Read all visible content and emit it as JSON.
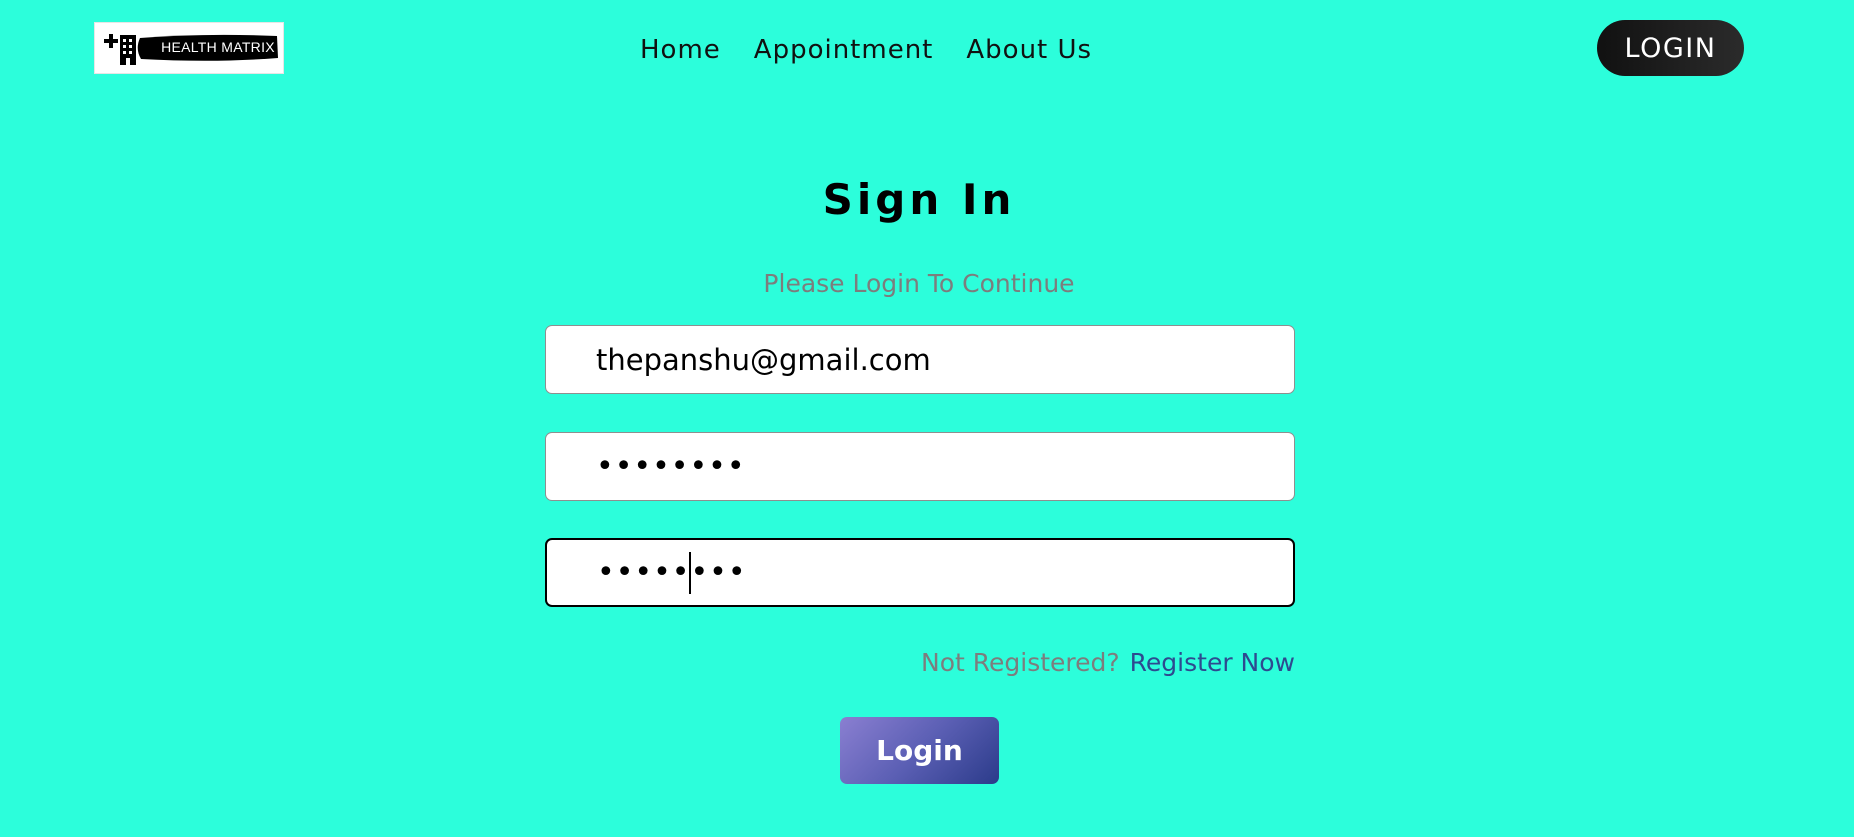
{
  "header": {
    "logo_text": "HEALTH MATRIX",
    "nav": [
      {
        "label": "Home"
      },
      {
        "label": "Appointment"
      },
      {
        "label": "About Us"
      }
    ],
    "login_button": "LOGIN"
  },
  "form": {
    "title": "Sign In",
    "subtitle": "Please Login To Continue",
    "email_value": "thepanshu@gmail.com",
    "password_mask": "••••••••",
    "confirm_password_mask": "••••••••",
    "register_prompt": "Not Registered?",
    "register_link": "Register Now",
    "submit_label": "Login"
  },
  "colors": {
    "background": "#2cfedb",
    "muted_text": "#7d7d7d",
    "link": "#2e4a8f",
    "button_gradient_start": "#8a7fd1",
    "button_gradient_end": "#2b3b8a",
    "header_button": "#111111"
  },
  "icons": {
    "logo": "hospital-cross-building-icon"
  }
}
